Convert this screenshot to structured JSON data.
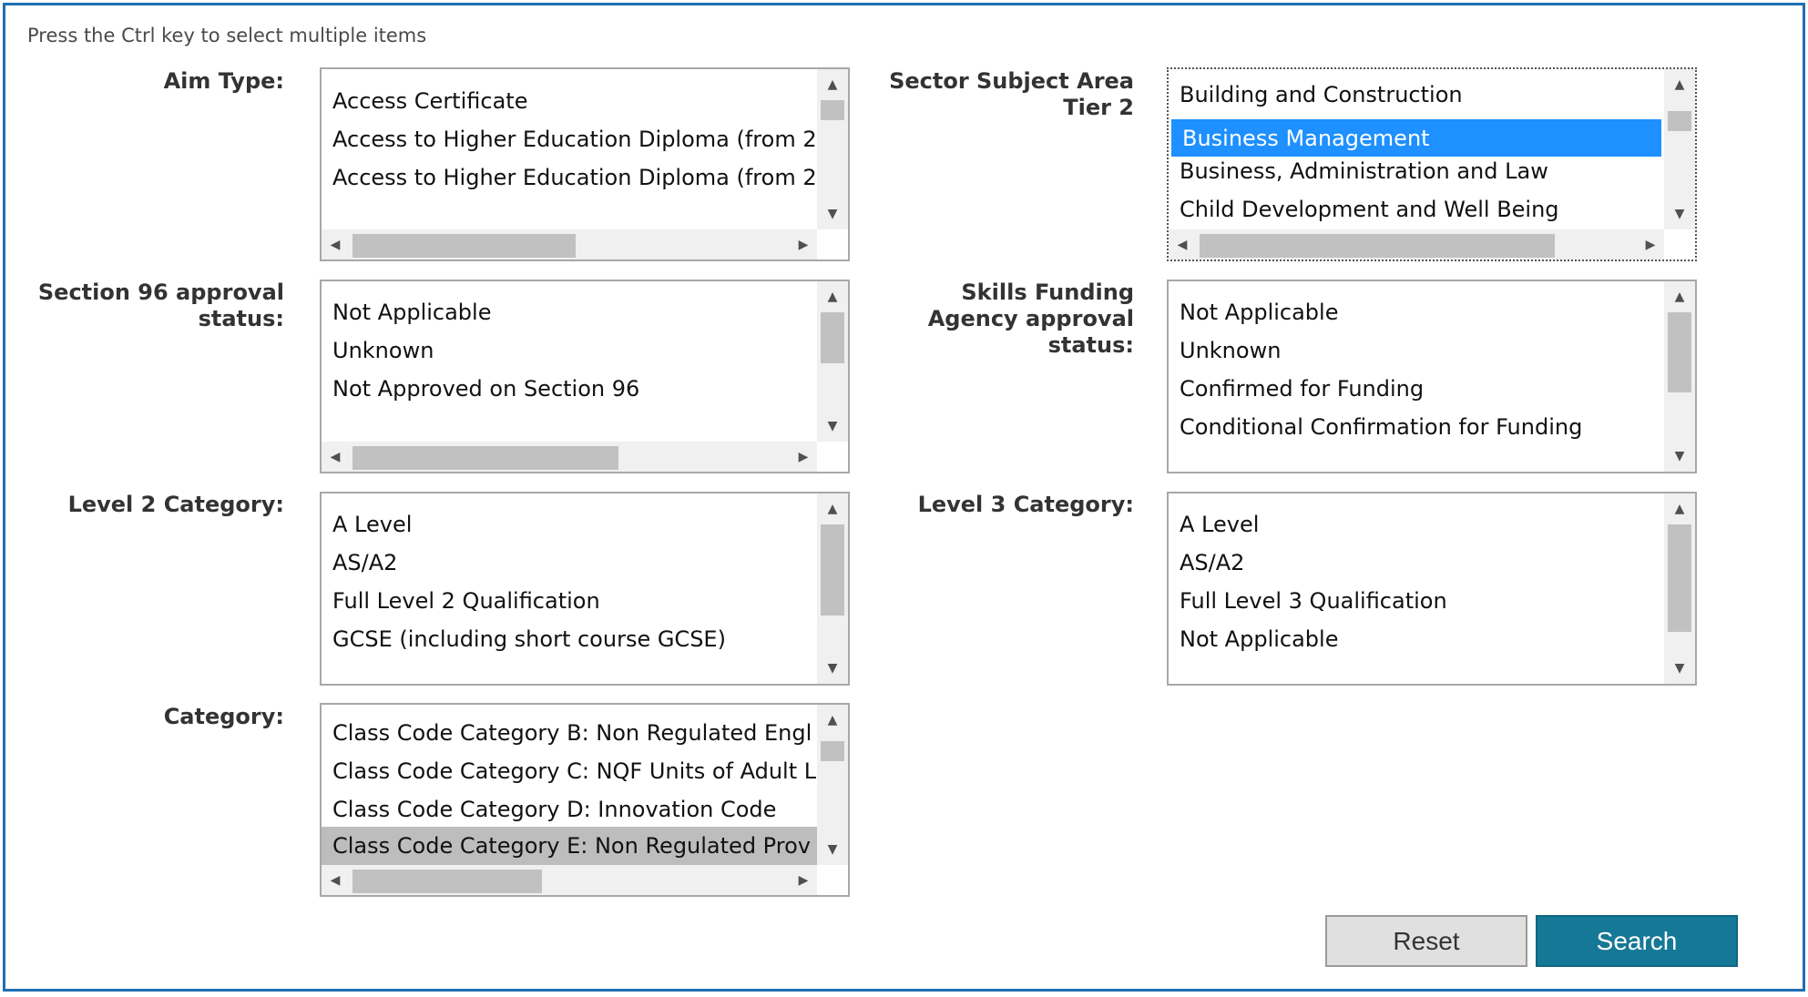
{
  "hint": "Press the Ctrl key to select multiple items",
  "fields": {
    "aim_type": {
      "label": "Aim Type:",
      "options": [
        "",
        "Access Certificate",
        "Access to Higher Education Diploma (from 2",
        "Access to Higher Education Diploma (from 2"
      ]
    },
    "sector_tier2": {
      "label_line1": "Sector Subject Area",
      "label_line2": "Tier 2",
      "options": [
        "Building and Construction",
        "Business Management",
        "Business, Administration and Law",
        "Child Development and Well Being"
      ],
      "selected": "Business Management"
    },
    "section96": {
      "label_line1": "Section 96 approval",
      "label_line2": "status:",
      "options": [
        "",
        "Not Applicable",
        "Unknown",
        "Not Approved on Section 96"
      ]
    },
    "sfa_status": {
      "label_line1": "Skills Funding",
      "label_line2": "Agency approval",
      "label_line3": "status:",
      "options": [
        "",
        "Not Applicable",
        "Unknown",
        "Confirmed for Funding",
        "Conditional Confirmation for Funding"
      ]
    },
    "level2": {
      "label": "Level 2 Category:",
      "options": [
        "",
        "A Level",
        "AS/A2",
        "Full Level 2 Qualification",
        "GCSE (including short course GCSE)"
      ]
    },
    "level3": {
      "label": "Level 3 Category:",
      "options": [
        "",
        "A Level",
        "AS/A2",
        "Full Level 3 Qualification",
        "Not Applicable"
      ]
    },
    "category": {
      "label": "Category:",
      "options": [
        "Class Code Category B: Non Regulated Engl",
        "Class Code Category C: NQF Units of Adult L",
        "Class Code Category D: Innovation Code",
        "Class Code Category E: Non Regulated Prov"
      ],
      "selected": "Class Code Category E: Non Regulated Prov"
    }
  },
  "buttons": {
    "reset": "Reset",
    "search": "Search"
  },
  "colors": {
    "frame": "#1f6fb4",
    "selected_blue": "#1e90ff",
    "search_button": "#157896"
  }
}
